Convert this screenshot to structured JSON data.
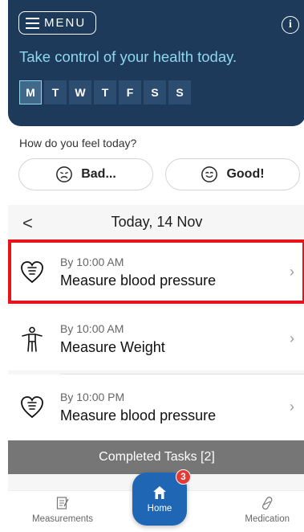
{
  "header": {
    "menu_label": "MENU",
    "info_glyph": "i",
    "tagline": "Take control of your health today.",
    "days": [
      "M",
      "T",
      "W",
      "T",
      "F",
      "S",
      "S"
    ],
    "active_day_index": 0
  },
  "mood": {
    "question": "How do you feel today?",
    "bad_label": "Bad...",
    "good_label": "Good!"
  },
  "date_nav": {
    "back_glyph": "<",
    "date": "Today, 14 Nov"
  },
  "tasks": [
    {
      "time": "By 10:00 AM",
      "title": "Measure blood pressure",
      "icon": "heart-icon",
      "highlighted": true
    },
    {
      "time": "By 10:00 AM",
      "title": "Measure Weight",
      "icon": "body-icon",
      "highlighted": false
    },
    {
      "time": "By 10:00 PM",
      "title": "Measure blood pressure",
      "icon": "heart-icon",
      "highlighted": false
    }
  ],
  "completed_label": "Completed Tasks [2]",
  "tabbar": {
    "measurements_label": "Measurements",
    "home_label": "Home",
    "home_badge": "3",
    "medication_label": "Medication"
  },
  "colors": {
    "header_bg": "#1d3a5b",
    "tagline": "#8fd7ee",
    "highlight": "#e8141b",
    "home_button": "#1f67b4",
    "badge": "#e53935",
    "completed_bar": "#767676"
  }
}
